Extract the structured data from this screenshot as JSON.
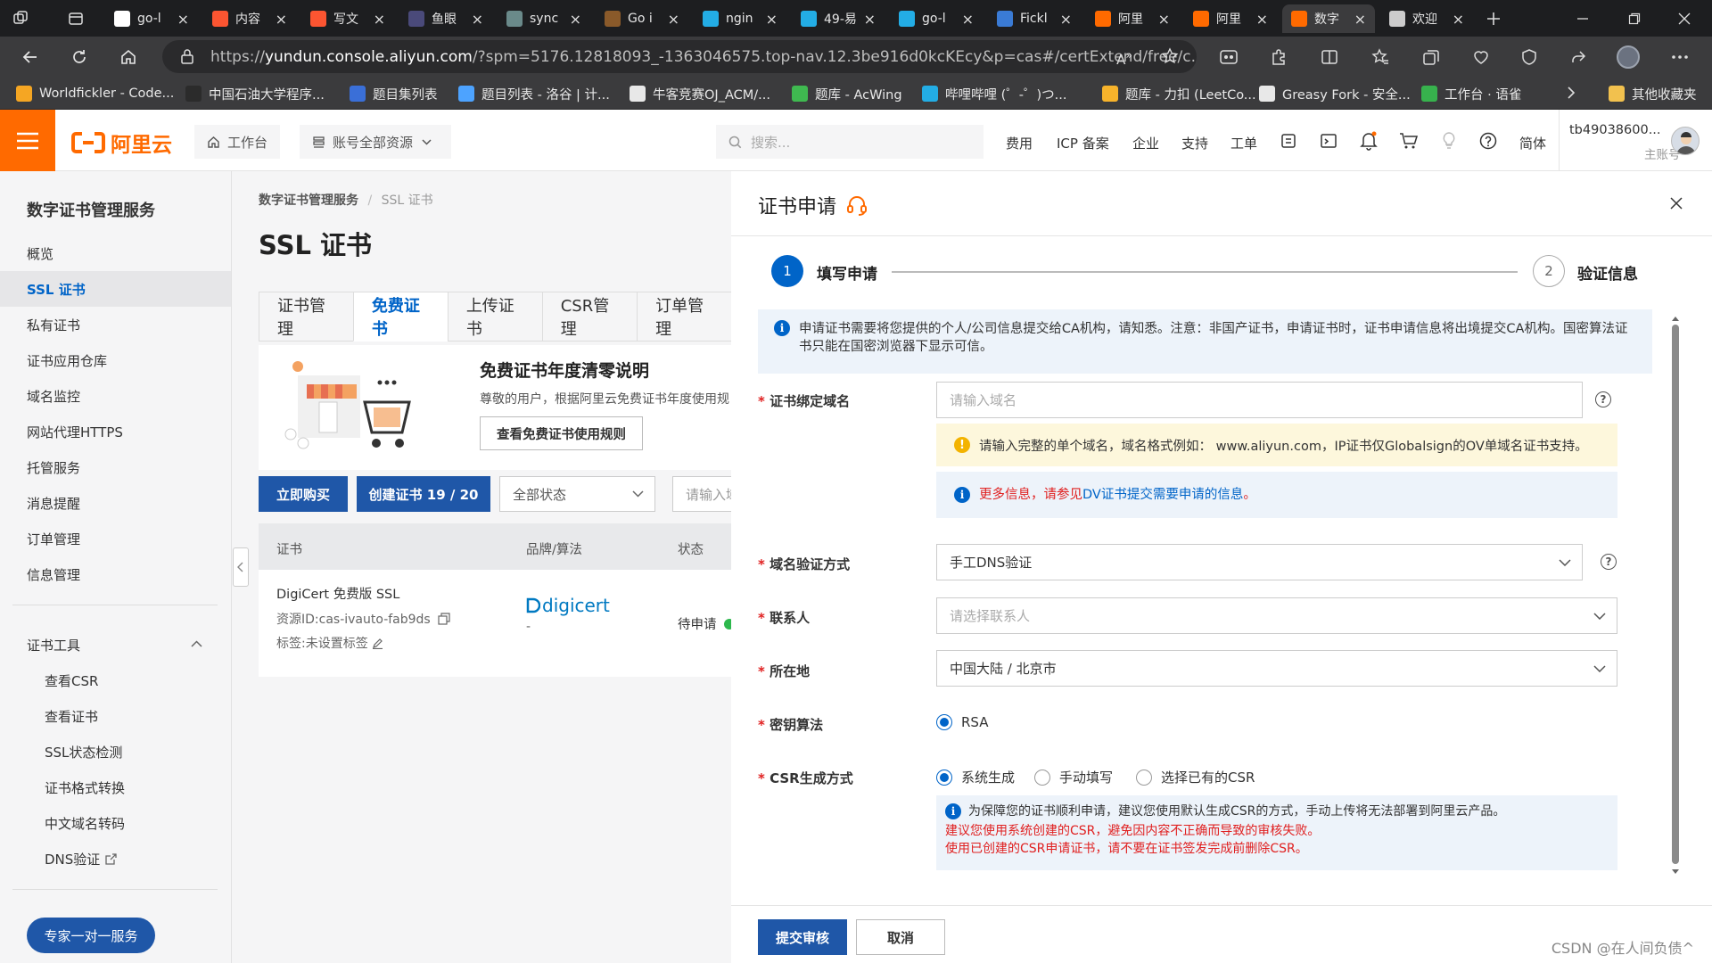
{
  "browser": {
    "tabs": [
      {
        "title": "go-l",
        "icon": "github-icon",
        "color": "#ffffff"
      },
      {
        "title": "内容",
        "icon": "csdn-icon",
        "color": "#fc5531"
      },
      {
        "title": "写文",
        "icon": "csdn-icon",
        "color": "#fc5531"
      },
      {
        "title": "鱼眼",
        "icon": "avatar-icon",
        "color": "#4a4a7a"
      },
      {
        "title": "sync",
        "icon": "page-icon",
        "color": "#6a8a8a"
      },
      {
        "title": "Go i",
        "icon": "bookmark-icon",
        "color": "#8a5a2a"
      },
      {
        "title": "ngin",
        "icon": "bilibili-icon",
        "color": "#23ade5"
      },
      {
        "title": "49-易",
        "icon": "bilibili-icon",
        "color": "#23ade5"
      },
      {
        "title": "go-l",
        "icon": "bilibili-icon",
        "color": "#23ade5"
      },
      {
        "title": "Fickl",
        "icon": "fickle-icon",
        "color": "#3a7bd5"
      },
      {
        "title": "阿里",
        "icon": "aliyun-icon",
        "color": "#ff6a00"
      },
      {
        "title": "阿里",
        "icon": "aliyun-icon",
        "color": "#ff6a00"
      },
      {
        "title": "数字",
        "icon": "aliyun-icon",
        "color": "#ff6a00"
      },
      {
        "title": "欢迎",
        "icon": "page-icon",
        "color": "#cccccc"
      }
    ],
    "url_host": "yundun.console.aliyun.com",
    "url_prefix": "https://",
    "url_rest": "/?spm=5176.12818093_-1363046575.top-nav.12.3be916d0kcKEcy&p=cas#/certExtend/free/c...",
    "bookmarks": [
      "Worldfickler - Code...",
      "中国石油大学程序...",
      "题目集列表",
      "题目列表 - 洛谷 | 计...",
      "牛客竞赛OJ_ACM/...",
      "题库 - AcWing",
      "哔哩哔哩 (゜-゜)つ...",
      "题库 - 力扣 (LeetCo...",
      "Greasy Fork - 安全...",
      "工作台 · 语雀"
    ],
    "bookmarks_other": "其他收藏夹"
  },
  "topnav": {
    "logo": "阿里云",
    "workbench": "工作台",
    "resources": "账号全部资源",
    "search_placeholder": "搜索...",
    "links": [
      "费用",
      "ICP 备案",
      "企业",
      "支持",
      "工单"
    ],
    "lang": "简体",
    "account": "tb49038600...",
    "account_role": "主账号"
  },
  "sidebar": {
    "title": "数字证书管理服务",
    "items": [
      "概览",
      "SSL 证书",
      "私有证书",
      "证书应用仓库",
      "域名监控",
      "网站代理HTTPS",
      "托管服务",
      "消息提醒",
      "订单管理",
      "信息管理"
    ],
    "tools_title": "证书工具",
    "tools": [
      "查看CSR",
      "查看证书",
      "SSL状态检测",
      "证书格式转换",
      "中文域名转码",
      "DNS验证"
    ],
    "expert_button": "专家一对一服务"
  },
  "main": {
    "breadcrumb_root": "数字证书管理服务",
    "breadcrumb_sep": "/",
    "breadcrumb_current": "SSL 证书",
    "title": "SSL 证书",
    "tabs": [
      "证书管理",
      "免费证书",
      "上传证书",
      "CSR管理",
      "订单管理"
    ],
    "notice_title": "免费证书年度清零说明",
    "notice_text": "尊敬的用户，根据阿里云免费证书年度使用规",
    "notice_button": "查看免费证书使用规则",
    "buy_button": "立即购买",
    "create_button": "创建证书 19 / 20",
    "status_select": "全部状态",
    "search_placeholder": "请输入域",
    "table_headers": [
      "证书",
      "品牌/算法",
      "状态"
    ],
    "row": {
      "name": "DigiCert 免费版 SSL",
      "resource_id": "资源ID:cas-ivauto-fab9ds",
      "tags": "标签:未设置标签",
      "brand": "digicert",
      "brand_sub": "-",
      "status": "待申请"
    }
  },
  "modal": {
    "title": "证书申请",
    "step1": {
      "num": "1",
      "label": "填写申请"
    },
    "step2": {
      "num": "2",
      "label": "验证信息"
    },
    "info_top": "申请证书需要将您提供的个人/公司信息提交给CA机构，请知悉。注意：非国产证书，申请证书时，证书申请信息将出境提交CA机构。国密算法证书只能在国密浏览器下显示可信。",
    "domain_label": "证书绑定域名",
    "domain_placeholder": "请输入域名",
    "domain_warning": "请输入完整的单个域名，域名格式例如： www.aliyun.com，IP证书仅Globalsign的OV单域名证书支持。",
    "more_info_prefix": "更多信息，请参见",
    "more_info_link": "DV证书提交需要申请的信息",
    "more_info_suffix": "。",
    "verify_label": "域名验证方式",
    "verify_value": "手工DNS验证",
    "contact_label": "联系人",
    "contact_placeholder": "请选择联系人",
    "location_label": "所在地",
    "location_value": "中国大陆 / 北京市",
    "algo_label": "密钥算法",
    "algo_option": "RSA",
    "csr_label": "CSR生成方式",
    "csr_options": [
      "系统生成",
      "手动填写",
      "选择已有的CSR"
    ],
    "csr_info": "为保障您的证书顺利申请，建议您使用默认生成CSR的方式，手动上传将无法部署到阿里云产品。",
    "csr_warn1": "建议您使用系统创建的CSR，避免因内容不正确而导致的审核失败。",
    "csr_warn2": "使用已创建的CSR申请证书，请不要在证书签发完成前删除CSR。",
    "submit": "提交审核",
    "cancel": "取消"
  },
  "watermark": "CSDN @在人间负债^"
}
